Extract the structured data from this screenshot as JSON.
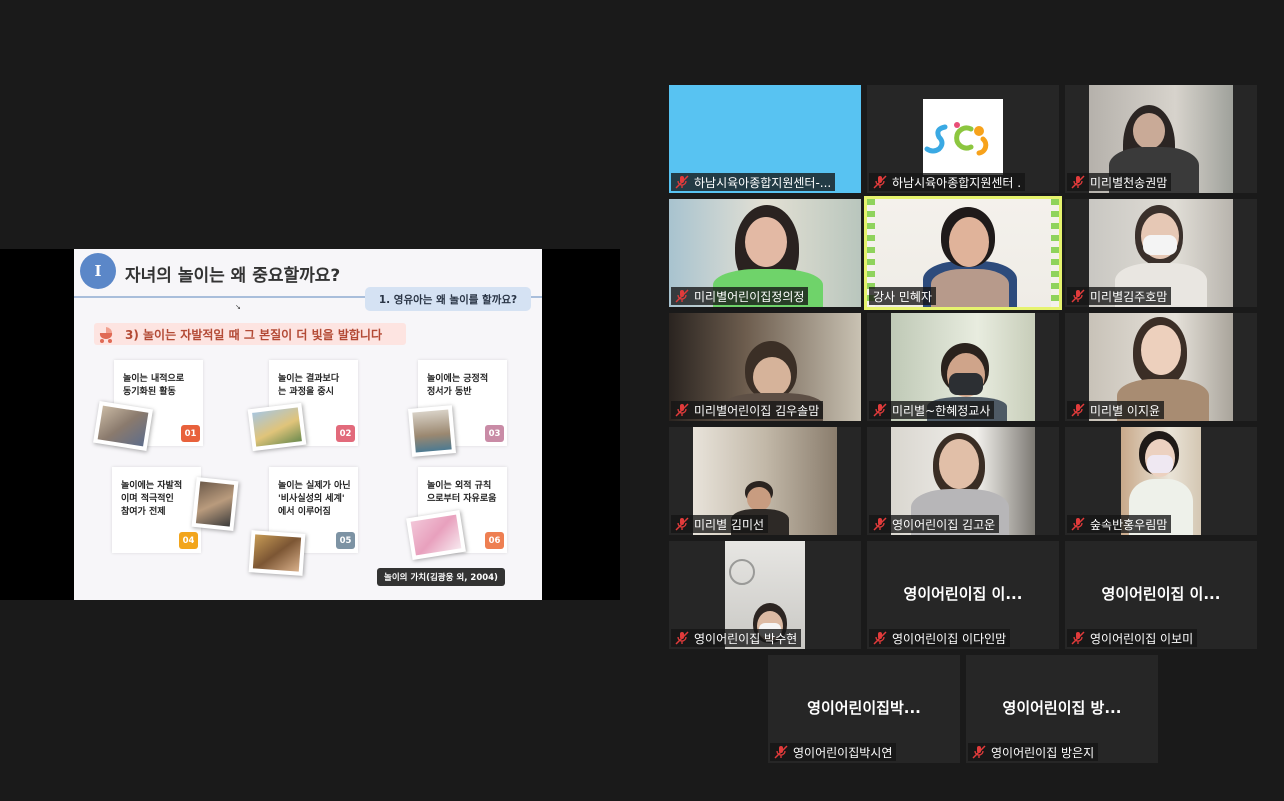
{
  "slide": {
    "badge": "I",
    "title": "자녀의 놀이는 왜 중요할까요?",
    "subtitle": "1. 영유아는 왜 놀이를 할까요?",
    "pointer": "↘",
    "heading": "3) 놀이는 자발적일 때 그 본질이 더 빛을 발합니다",
    "cards": [
      {
        "text": "놀이는 내적으로\n동기화된 활동",
        "num": "01",
        "color": "#e8613c"
      },
      {
        "text": "놀이는 결과보다\n는 과정을 중시",
        "num": "02",
        "color": "#e26a7b"
      },
      {
        "text": "놀이에는 긍정적\n정서가 동반",
        "num": "03",
        "color": "#c98ba6"
      },
      {
        "text": "놀이에는 자발적\n이며 적극적인\n참여가 전제",
        "num": "04",
        "color": "#f2a51c"
      },
      {
        "text": "놀이는 실제가 아닌\n'비사실성의 세계'\n에서 이루어짐",
        "num": "05",
        "color": "#7d93a4"
      },
      {
        "text": "놀이는 외적 규칙\n으로부터 자유로움",
        "num": "06",
        "color": "#ee7f52"
      }
    ],
    "source": "놀이의 가치(김광웅 외, 2004)"
  },
  "participants": [
    {
      "name": "하남시육아종합지원센터-...",
      "video": "blue",
      "muted": true
    },
    {
      "name": "하남시육아종합지원센터 .",
      "video": "logo",
      "muted": true
    },
    {
      "name": "미리별천송권맘",
      "video": "cam",
      "muted": true
    },
    {
      "name": "미리별어린이집정의정",
      "video": "cam",
      "muted": true
    },
    {
      "name": "강사 민혜자",
      "video": "cam",
      "muted": false,
      "active": true
    },
    {
      "name": "미리별김주호맘",
      "video": "cam",
      "muted": true
    },
    {
      "name": "미리별어린이집 김우솔맘",
      "video": "cam",
      "muted": true
    },
    {
      "name": "미리별~한혜정교사",
      "video": "cam",
      "muted": true
    },
    {
      "name": "미리별 이지윤",
      "video": "cam",
      "muted": true
    },
    {
      "name": "미리별 김미선",
      "video": "cam",
      "muted": true
    },
    {
      "name": "영이어린이집 김고운",
      "video": "cam",
      "muted": true
    },
    {
      "name": "숲속반홍우림맘",
      "video": "cam",
      "muted": true
    },
    {
      "name": "영이어린이집 박수현",
      "video": "cam",
      "muted": true
    },
    {
      "name": "영이어린이집 이다인맘",
      "video": "none",
      "center": "영이어린이집 이...",
      "muted": true
    },
    {
      "name": "영이어린이집 이보미",
      "video": "none",
      "center": "영이어린이집 이...",
      "muted": true
    },
    {
      "name": "영이어린이집박시연",
      "video": "none",
      "center": "영이어린이집박...",
      "muted": true
    },
    {
      "name": "영이어린이집 방은지",
      "video": "none",
      "center": "영이어린이집 방...",
      "muted": true
    }
  ],
  "colors": {
    "active_border": "#e6f36e",
    "muted_icon": "#e23b3b",
    "tile_bg": "#262626",
    "app_bg": "#1a1a1a"
  }
}
